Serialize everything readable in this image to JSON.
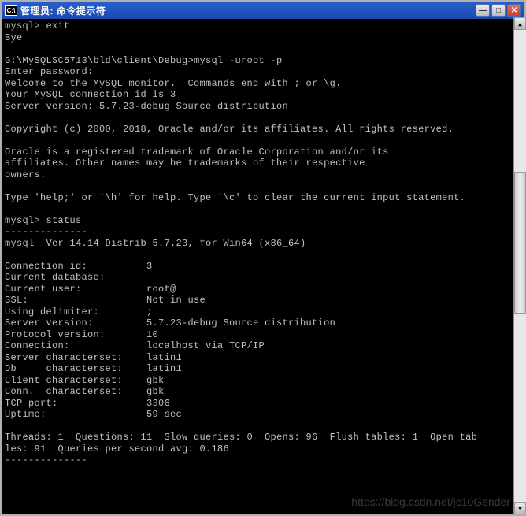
{
  "titlebar": {
    "icon_text": "C:\\",
    "title": "管理员: 命令提示符"
  },
  "window_controls": {
    "minimize": "—",
    "maximize": "□",
    "close": "✕"
  },
  "terminal": {
    "lines": [
      "mysql> exit",
      "Bye",
      "",
      "G:\\MySQLSC5713\\bld\\client\\Debug>mysql -uroot -p",
      "Enter password:",
      "Welcome to the MySQL monitor.  Commands end with ; or \\g.",
      "Your MySQL connection id is 3",
      "Server version: 5.7.23-debug Source distribution",
      "",
      "Copyright (c) 2000, 2018, Oracle and/or its affiliates. All rights reserved.",
      "",
      "Oracle is a registered trademark of Oracle Corporation and/or its",
      "affiliates. Other names may be trademarks of their respective",
      "owners.",
      "",
      "Type 'help;' or '\\h' for help. Type '\\c' to clear the current input statement.",
      "",
      "mysql> status",
      "--------------",
      "mysql  Ver 14.14 Distrib 5.7.23, for Win64 (x86_64)",
      "",
      "Connection id:          3",
      "Current database:",
      "Current user:           root@",
      "SSL:                    Not in use",
      "Using delimiter:        ;",
      "Server version:         5.7.23-debug Source distribution",
      "Protocol version:       10",
      "Connection:             localhost via TCP/IP",
      "Server characterset:    latin1",
      "Db     characterset:    latin1",
      "Client characterset:    gbk",
      "Conn.  characterset:    gbk",
      "TCP port:               3306",
      "Uptime:                 59 sec",
      "",
      "Threads: 1  Questions: 11  Slow queries: 0  Opens: 96  Flush tables: 1  Open tab",
      "les: 91  Queries per second avg: 0.186",
      "--------------"
    ]
  },
  "scrollbar": {
    "up": "▲",
    "down": "▼"
  },
  "watermark": "https://blog.csdn.net/jc10Gender"
}
